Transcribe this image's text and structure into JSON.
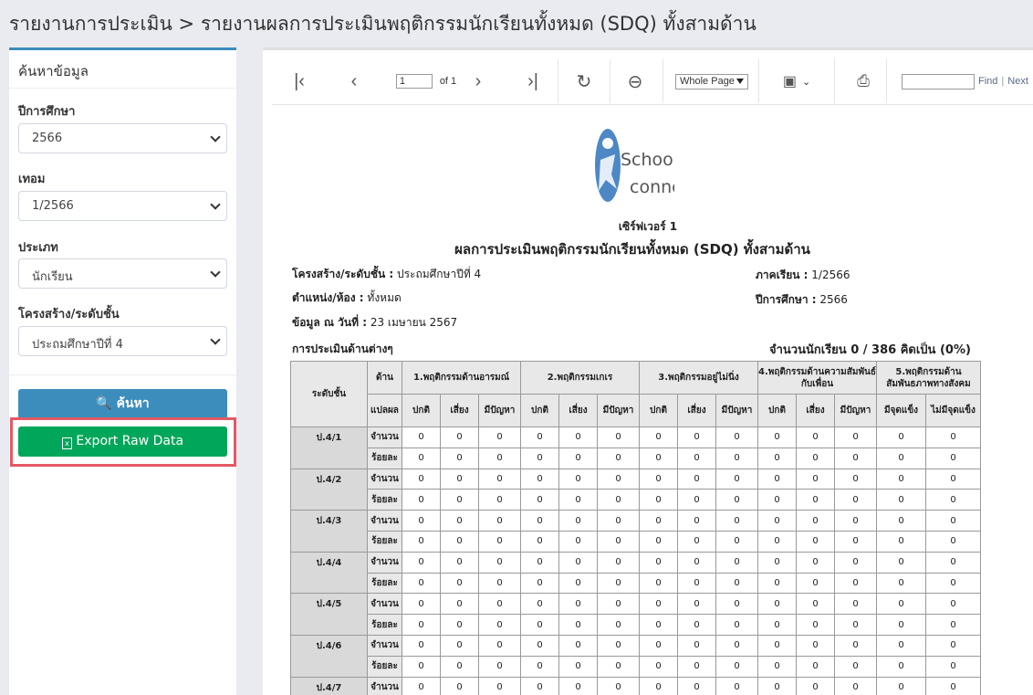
{
  "breadcrumb": {
    "parent": "รายงานการประเมิน",
    "separator": ">",
    "current": "รายงานผลการประเมินพฤติกรรมนักเรียนทั้งหมด (SDQ) ทั้งสามด้าน"
  },
  "search_panel": {
    "title": "ค้นหาข้อมูล",
    "fields": [
      {
        "label": "ปีการศึกษา",
        "value": "2566"
      },
      {
        "label": "เทอม",
        "value": "1/2566"
      },
      {
        "label": "ประเภท",
        "value": "นักเรียน"
      },
      {
        "label": "โครงสร้าง/ระดับชั้น",
        "value": "ประถมศึกษาปีที่ 4"
      }
    ],
    "search_label": "ค้นหา",
    "export_label": "Export Raw Data"
  },
  "toolbar": {
    "page_value": "1",
    "page_of": "of 1",
    "zoom": "Whole Page",
    "find": "Find",
    "next": "Next",
    "divider": "|"
  },
  "report": {
    "logo_text_1": "School",
    "logo_text_2": "connex",
    "server": "เซิร์ฟเวอร์ 1",
    "title": "ผลการประเมินพฤติกรรมนักเรียนทั้งหมด (SDQ) ทั้งสามด้าน",
    "structure_label": "โครงสร้าง/ระดับชั้น :",
    "structure_value": "ประถมศึกษาปีที่ 4",
    "room_label": "ตำแหน่ง/ห้อง :",
    "room_value": "ทั้งหมด",
    "data_date_label": "ข้อมูล ณ วันที่ :",
    "data_date_value": "23 เมษายน 2567",
    "term_label": "ภาคเรียน :",
    "term_value": "1/2566",
    "year_label": "ปีการศึกษา :",
    "year_value": "2566",
    "section_label": "การประเมินด้านต่างๆ",
    "count_text": "จำนวนนักเรียน 0 / 386 คิดเป็น (0%)"
  },
  "table": {
    "level_header": "ระดับชั้น",
    "side_header": "ด้าน",
    "translate_header": "แปลผล",
    "groups": [
      {
        "title": "1.พฤติกรรมด้านอารมณ์",
        "cols": [
          "ปกติ",
          "เสี่ยง",
          "มีปัญหา"
        ]
      },
      {
        "title": "2.พฤติกรรมเกเร",
        "cols": [
          "ปกติ",
          "เสี่ยง",
          "มีปัญหา"
        ]
      },
      {
        "title": "3.พฤติกรรมอยู่ไม่นิ่ง",
        "cols": [
          "ปกติ",
          "เสี่ยง",
          "มีปัญหา"
        ]
      },
      {
        "title": "4.พฤติกรรมด้านความสัมพันธ์กับเพื่อน",
        "cols": [
          "ปกติ",
          "เสี่ยง",
          "มีปัญหา"
        ]
      },
      {
        "title": "5.พฤติกรรมด้านสัมพันธภาพทางสังคม",
        "cols": [
          "มีจุดแข็ง",
          "ไม่มีจุดแข็ง"
        ]
      }
    ],
    "row_labels": [
      "จำนวน",
      "ร้อยละ"
    ],
    "levels": [
      {
        "name": "ป.4/1",
        "count": [
          "0",
          "0",
          "0",
          "0",
          "0",
          "0",
          "0",
          "0",
          "0",
          "0",
          "0",
          "0",
          "0",
          "0"
        ],
        "percent": [
          "0",
          "0",
          "0",
          "0",
          "0",
          "0",
          "0",
          "0",
          "0",
          "0",
          "0",
          "0",
          "0",
          "0"
        ]
      },
      {
        "name": "ป.4/2",
        "count": [
          "0",
          "0",
          "0",
          "0",
          "0",
          "0",
          "0",
          "0",
          "0",
          "0",
          "0",
          "0",
          "0",
          "0"
        ],
        "percent": [
          "0",
          "0",
          "0",
          "0",
          "0",
          "0",
          "0",
          "0",
          "0",
          "0",
          "0",
          "0",
          "0",
          "0"
        ]
      },
      {
        "name": "ป.4/3",
        "count": [
          "0",
          "0",
          "0",
          "0",
          "0",
          "0",
          "0",
          "0",
          "0",
          "0",
          "0",
          "0",
          "0",
          "0"
        ],
        "percent": [
          "0",
          "0",
          "0",
          "0",
          "0",
          "0",
          "0",
          "0",
          "0",
          "0",
          "0",
          "0",
          "0",
          "0"
        ]
      },
      {
        "name": "ป.4/4",
        "count": [
          "0",
          "0",
          "0",
          "0",
          "0",
          "0",
          "0",
          "0",
          "0",
          "0",
          "0",
          "0",
          "0",
          "0"
        ],
        "percent": [
          "0",
          "0",
          "0",
          "0",
          "0",
          "0",
          "0",
          "0",
          "0",
          "0",
          "0",
          "0",
          "0",
          "0"
        ]
      },
      {
        "name": "ป.4/5",
        "count": [
          "0",
          "0",
          "0",
          "0",
          "0",
          "0",
          "0",
          "0",
          "0",
          "0",
          "0",
          "0",
          "0",
          "0"
        ],
        "percent": [
          "0",
          "0",
          "0",
          "0",
          "0",
          "0",
          "0",
          "0",
          "0",
          "0",
          "0",
          "0",
          "0",
          "0"
        ]
      },
      {
        "name": "ป.4/6",
        "count": [
          "0",
          "0",
          "0",
          "0",
          "0",
          "0",
          "0",
          "0",
          "0",
          "0",
          "0",
          "0",
          "0",
          "0"
        ],
        "percent": [
          "0",
          "0",
          "0",
          "0",
          "0",
          "0",
          "0",
          "0",
          "0",
          "0",
          "0",
          "0",
          "0",
          "0"
        ]
      },
      {
        "name": "ป.4/7",
        "count": [
          "0",
          "0",
          "0",
          "0",
          "0",
          "0",
          "0",
          "0",
          "0",
          "0",
          "0",
          "0",
          "0",
          "0"
        ],
        "percent": []
      }
    ]
  },
  "colors": {
    "primary": "#3c8dbc",
    "success": "#00a65a",
    "highlight": "#e55865"
  },
  "icons": [
    "first-page-icon",
    "prev-page-icon",
    "next-page-icon",
    "last-page-icon",
    "refresh-icon",
    "back-icon",
    "save-icon",
    "print-icon",
    "search-icon",
    "excel-icon"
  ]
}
